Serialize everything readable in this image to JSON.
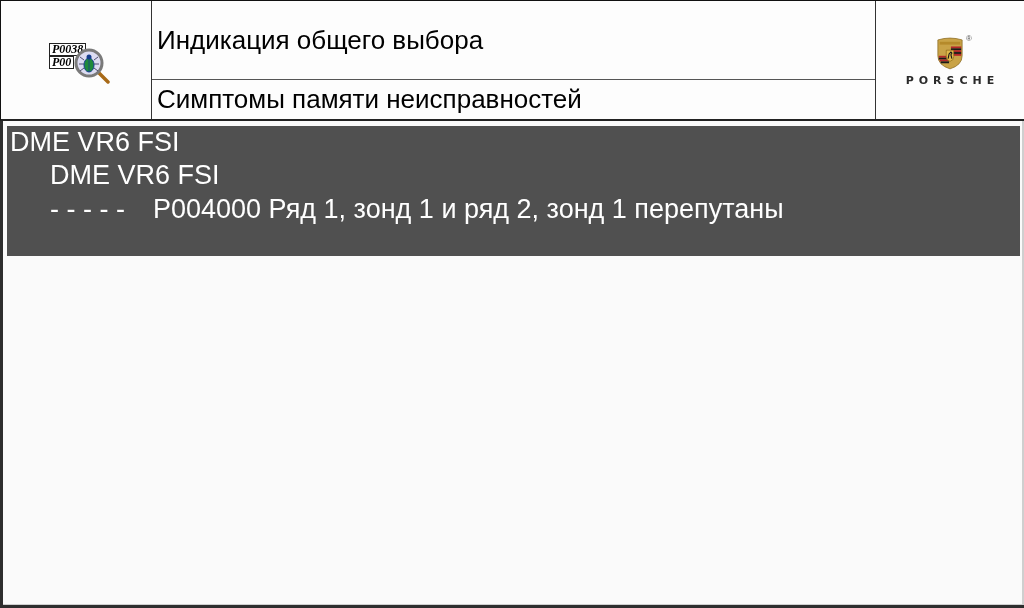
{
  "header": {
    "icon_codes": [
      "P0038",
      "P00"
    ],
    "title": "Индикация общего выбора",
    "subtitle": "Симптомы памяти неисправностей"
  },
  "logo": {
    "wordmark": "PORSCHE",
    "registered_mark": "®"
  },
  "fault_memory": [
    {
      "label": "DME VR6 FSI",
      "selected": true,
      "children": [
        {
          "kind": "unit",
          "label": "DME VR6 FSI"
        },
        {
          "kind": "fault",
          "status": "- - - - -",
          "description": "P004000 Ряд 1, зонд 1 и ряд 2, зонд 1 перепутаны"
        }
      ]
    }
  ]
}
